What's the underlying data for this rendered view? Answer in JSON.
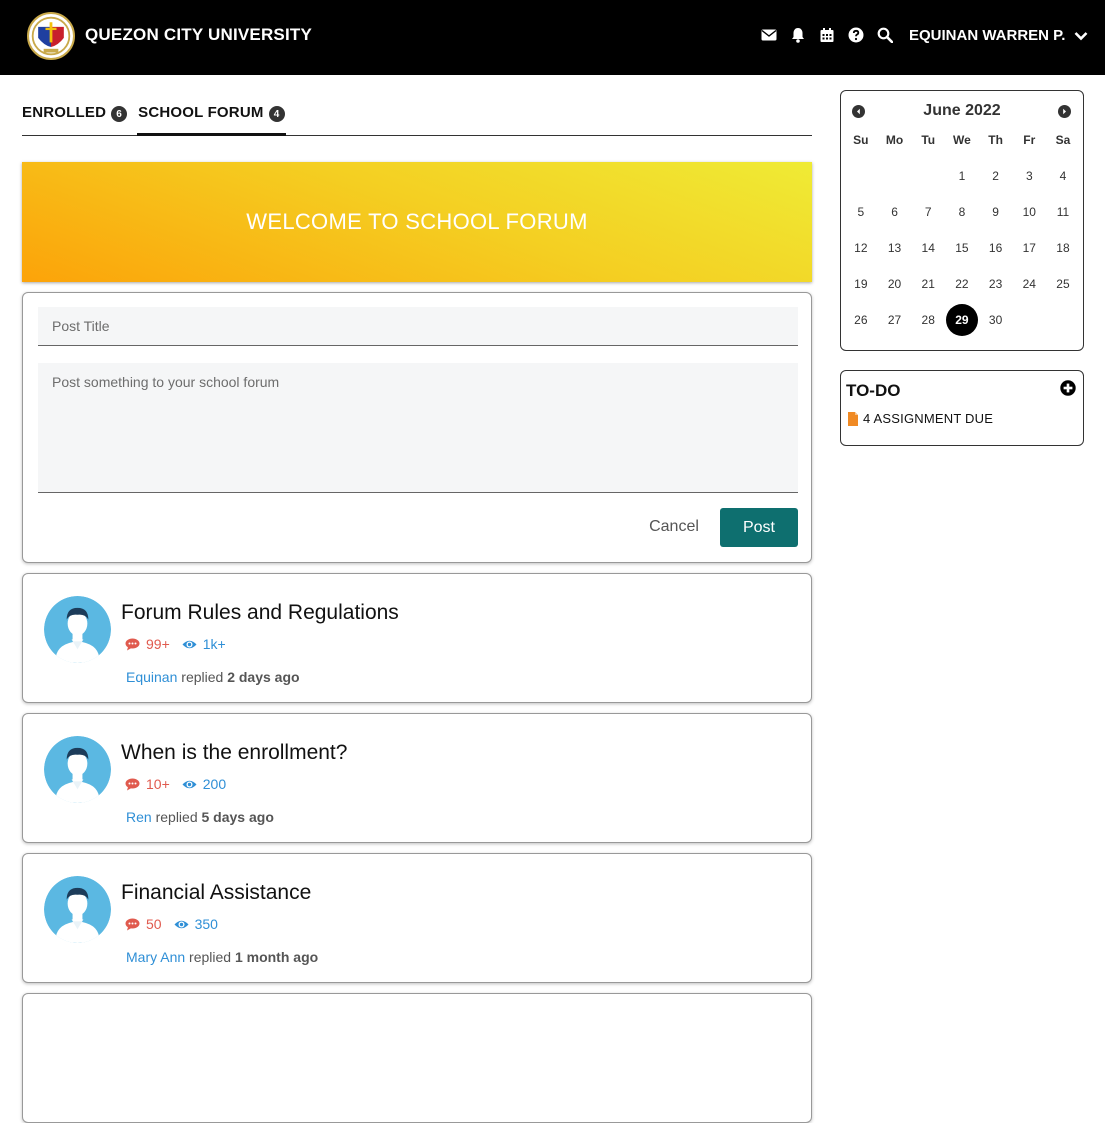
{
  "header": {
    "brand": "QUEZON CITY UNIVERSITY",
    "icons": [
      "envelope-icon",
      "bell-icon",
      "calendar-icon",
      "help-icon",
      "search-icon"
    ],
    "user_name": "EQUINAN WARREN P."
  },
  "tabs": [
    {
      "label": "ENROLLED",
      "count": "6",
      "active": false
    },
    {
      "label": "SCHOOL FORUM",
      "count": "4",
      "active": true
    }
  ],
  "banner": {
    "text": "WELCOME TO SCHOOL FORUM"
  },
  "post_form": {
    "title_placeholder": "Post Title",
    "body_placeholder": "Post something to your school forum",
    "cancel_label": "Cancel",
    "post_label": "Post"
  },
  "threads": [
    {
      "title": "Forum Rules and Regulations",
      "replies": "99+",
      "views": "1k+",
      "author": "Equinan",
      "action": "replied",
      "when": "2 days ago"
    },
    {
      "title": "When is the enrollment?",
      "replies": "10+",
      "views": "200",
      "author": "Ren",
      "action": "replied",
      "when": "5 days ago"
    },
    {
      "title": "Financial Assistance",
      "replies": "50",
      "views": "350",
      "author": "Mary Ann",
      "action": "replied",
      "when": "1 month ago"
    }
  ],
  "calendar": {
    "title": "June 2022",
    "weekdays": [
      "Su",
      "Mo",
      "Tu",
      "We",
      "Th",
      "Fr",
      "Sa"
    ],
    "leading_blanks": 3,
    "days": 30,
    "selected": "29"
  },
  "todo": {
    "title": "TO-DO",
    "item": "4 ASSIGNMENT DUE"
  },
  "colors": {
    "topbar": "#000000",
    "post_button": "#0e6f6f",
    "replies": "#e05a4e",
    "views": "#2f8fd6",
    "banner_start": "#efeb35",
    "banner_end": "#fca309",
    "todo_file": "#f08a24"
  }
}
